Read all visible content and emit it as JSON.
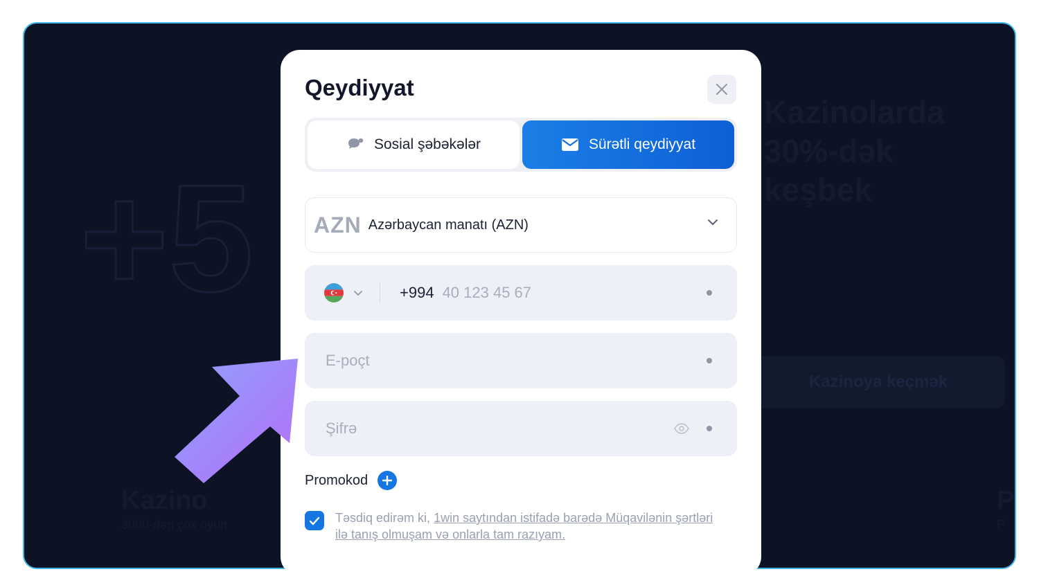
{
  "background": {
    "heading_lines": [
      "Kazinolarda",
      "30%-dək",
      "keşbek"
    ],
    "big_text": "+5",
    "cta_label": "Kazinoya keçmək",
    "card_left_title": "Kazino",
    "card_left_sub": "3000-dən çox oyun",
    "card_right_title": "P",
    "card_right_sub": "P"
  },
  "modal": {
    "title": "Qeydiyyat",
    "tabs": {
      "social_label": "Sosial şəbəkələr",
      "fast_label": "Sürətli qeydiyyat"
    },
    "currency": {
      "code": "AZN",
      "name": "Azərbaycan manatı (AZN)"
    },
    "phone": {
      "dial_code": "+994",
      "placeholder": "40 123 45 67"
    },
    "email": {
      "placeholder": "E-poçt"
    },
    "password": {
      "placeholder": "Şifrə"
    },
    "promo": {
      "label": "Promokod"
    },
    "terms": {
      "prefix": "Təsdiq edirəm ki, ",
      "link": "1win saytından istifadə barədə Müqavilənin şərtləri ilə tanış olmuşam və onlarla tam razıyam."
    }
  },
  "colors": {
    "accent": "#1576e2",
    "frame_border": "#3fb6e8",
    "background": "#0d1324"
  }
}
